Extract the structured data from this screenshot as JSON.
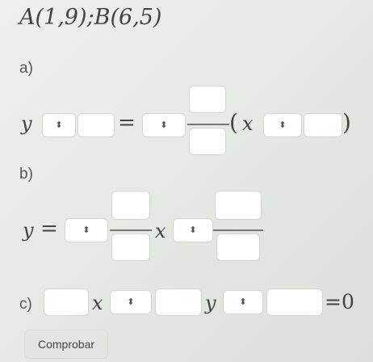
{
  "title": {
    "text": "A(1,9);B(6,5)"
  },
  "parts": {
    "a": {
      "label": "a)",
      "y": "y",
      "x": "x",
      "eq": "=",
      "lparen": "(",
      "rparen": ")"
    },
    "b": {
      "label": "b)",
      "y": "y",
      "x": "x",
      "eq": "="
    },
    "c": {
      "label": "c)",
      "x": "x",
      "y": "y",
      "eq_zero": "=0"
    }
  },
  "selector": {
    "glyph": "⬍"
  },
  "check_button": {
    "label": "Comprobar"
  }
}
